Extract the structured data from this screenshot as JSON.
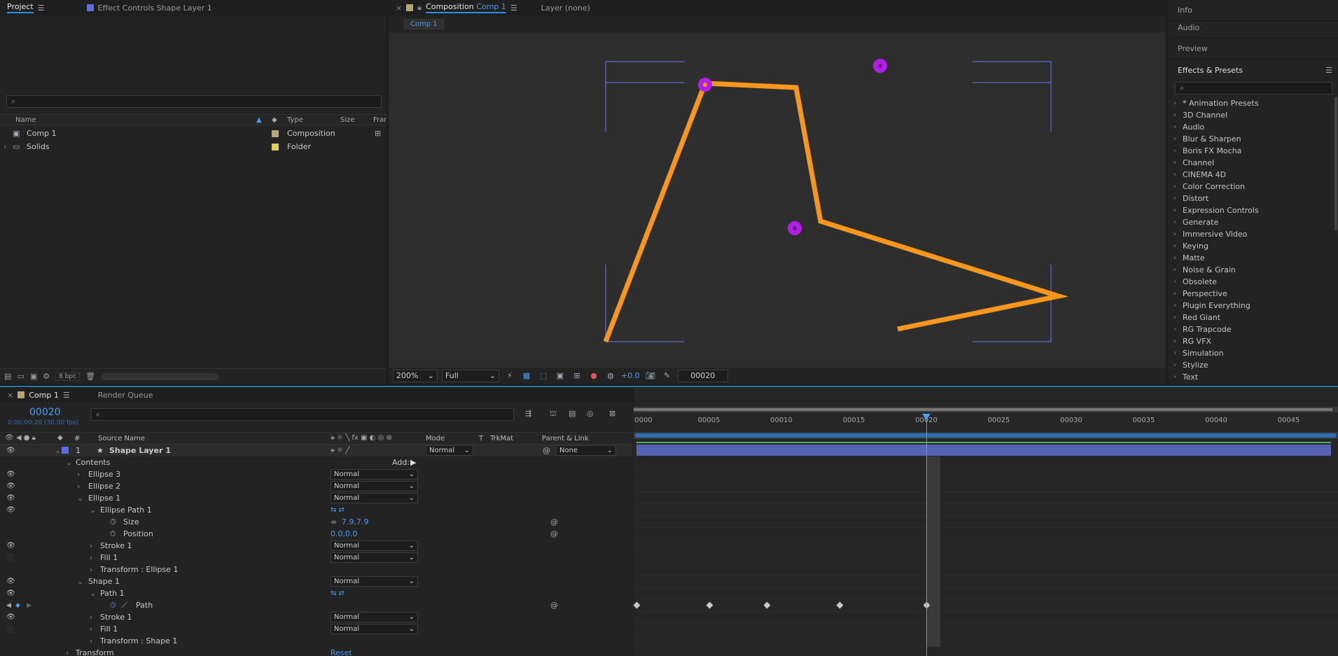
{
  "project": {
    "tab_label": "Project",
    "effect_controls_label": "Effect Controls Shape Layer 1",
    "search_placeholder": "",
    "columns": {
      "name": "Name",
      "type": "Type",
      "size": "Size",
      "frame": "Fran"
    },
    "items": [
      {
        "name": "Comp 1",
        "type": "Composition",
        "color": "#b5a57b"
      },
      {
        "name": "Solids",
        "type": "Folder",
        "color": "#e3cf5b"
      }
    ],
    "footer_bpc": "8 bpc"
  },
  "composition": {
    "tab_prefix": "Composition",
    "tab_comp": "Comp 1",
    "layer_tab": "Layer (none)",
    "breadcrumb": "Comp 1",
    "footer": {
      "zoom": "200%",
      "resolution": "Full",
      "exposure": "+0.0",
      "timecode": "00020"
    },
    "colors": {
      "stroke": "#f7971e",
      "ellipse": "#b21fe6",
      "guides": "#5f6fd6"
    }
  },
  "right_panels": {
    "tabs": [
      "Info",
      "Audio",
      "Preview"
    ],
    "effects_title": "Effects & Presets",
    "search_placeholder": "",
    "effects": [
      "* Animation Presets",
      "3D Channel",
      "Audio",
      "Blur & Sharpen",
      "Boris FX Mocha",
      "Channel",
      "CINEMA 4D",
      "Color Correction",
      "Distort",
      "Expression Controls",
      "Generate",
      "Immersive Video",
      "Keying",
      "Matte",
      "Noise & Grain",
      "Obsolete",
      "Perspective",
      "Plugin Everything",
      "Red Giant",
      "RG Trapcode",
      "RG VFX",
      "Simulation",
      "Stylize",
      "Text"
    ]
  },
  "timeline": {
    "tab_label": "Comp 1",
    "render_queue_label": "Render Queue",
    "current_time": "00020",
    "current_time_sub": "0:00:00:20 (30.00 fps)",
    "headers": {
      "number": "#",
      "source_name": "Source Name",
      "mode": "Mode",
      "t": "T",
      "trkmat": "TrkMat",
      "parent": "Parent & Link"
    },
    "ruler": [
      "0000",
      "00005",
      "00010",
      "00015",
      "00020",
      "00025",
      "00030",
      "00035",
      "00040",
      "00045"
    ],
    "layer": {
      "index": "1",
      "name": "Shape Layer 1",
      "mode": "Normal",
      "parent": "None"
    },
    "contents_label": "Contents",
    "add_label": "Add:",
    "rows": {
      "ellipse3": "Ellipse 3",
      "ellipse2": "Ellipse 2",
      "ellipse1": "Ellipse 1",
      "ellipse_path1": "Ellipse Path 1",
      "size_label": "Size",
      "size_value": "7.9,7.9",
      "position_label": "Position",
      "position_value": "0.0,0.0",
      "stroke1_a": "Stroke 1",
      "fill1_a": "Fill 1",
      "transform_ellipse": "Transform : Ellipse 1",
      "shape1": "Shape 1",
      "path1": "Path 1",
      "path_label": "Path",
      "stroke1_b": "Stroke 1",
      "fill1_b": "Fill 1",
      "transform_shape": "Transform : Shape 1",
      "transform": "Transform",
      "reset": "Reset"
    },
    "mode_normal": "Normal",
    "keyframe_frames": [
      0,
      5,
      9,
      14,
      20
    ]
  }
}
